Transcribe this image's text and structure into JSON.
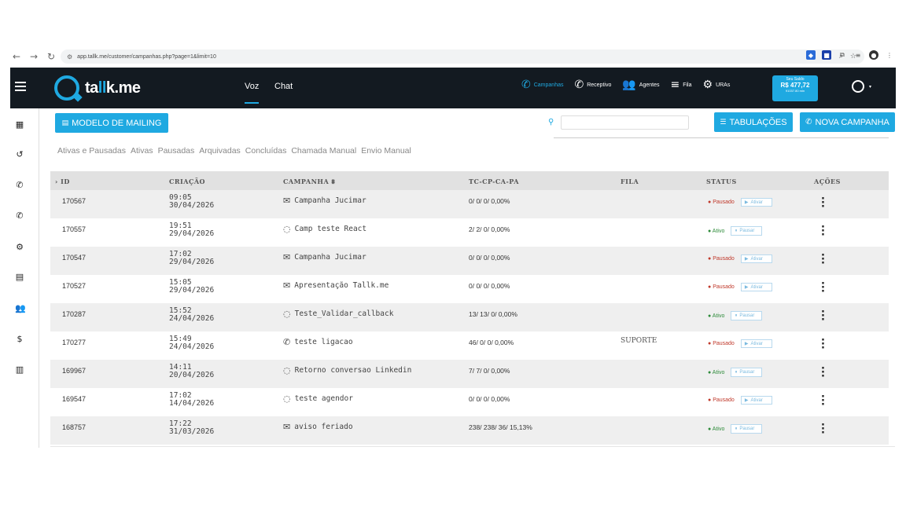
{
  "browser": {
    "url": "app.tallk.me/customer/campanhas.php?page=1&limit=10"
  },
  "topnav": {
    "logo_prefix": "ta",
    "logo_highlight": "ll",
    "logo_suffix": "k.me",
    "tabs": [
      "Voz",
      "Chat"
    ],
    "links": [
      "Campanhas",
      "Receptivo",
      "Agentes",
      "Fila",
      "URAs"
    ],
    "saldo_label": "Seu Saldo",
    "saldo_value": "R$ 477,72",
    "saldo_sub": "91037.80 min"
  },
  "toolbar": {
    "mailing_button": "MODELO DE MAILING",
    "tabulacoes_button": "TABULAÇÕES",
    "nova_campanha_button": "NOVA CAMPANHA",
    "search_placeholder": ""
  },
  "filters": [
    "Ativas e Pausadas",
    "Ativas",
    "Pausadas",
    "Arquivadas",
    "Concluídas",
    "Chamada Manual",
    "Envio Manual"
  ],
  "table": {
    "headers": {
      "id": "ID",
      "criacao": "CRIAÇÃO",
      "campanha": "CAMPANHA",
      "tc": "TC-CP-CA-PA",
      "fila": "FILA",
      "status": "STATUS",
      "acoes": "AÇÕES"
    },
    "rows": [
      {
        "id": "170567",
        "time": "09:05",
        "date": "30/04/2026",
        "icon": "envelope-icon",
        "name": "Campanha Jucimar",
        "tc": "0/ 0/ 0/ 0,00%",
        "fila": "",
        "status": "Pausado",
        "action": "Ativar"
      },
      {
        "id": "170557",
        "time": "19:51",
        "date": "29/04/2026",
        "icon": "whatsapp-icon",
        "name": "Camp teste React",
        "tc": "2/ 2/ 0/ 0,00%",
        "fila": "",
        "status": "Ativo",
        "action": "Pausar"
      },
      {
        "id": "170547",
        "time": "17:02",
        "date": "29/04/2026",
        "icon": "envelope-icon",
        "name": "Campanha Jucimar",
        "tc": "0/ 0/ 0/ 0,00%",
        "fila": "",
        "status": "Pausado",
        "action": "Ativar"
      },
      {
        "id": "170527",
        "time": "15:05",
        "date": "29/04/2026",
        "icon": "envelope-icon",
        "name": "Apresentação Tallk.me",
        "tc": "0/ 0/ 0/ 0,00%",
        "fila": "",
        "status": "Pausado",
        "action": "Ativar"
      },
      {
        "id": "170287",
        "time": "15:52",
        "date": "24/04/2026",
        "icon": "whatsapp-icon",
        "name": "Teste_Validar_callback",
        "tc": "13/ 13/ 0/ 0,00%",
        "fila": "",
        "status": "Ativo",
        "action": "Pausar"
      },
      {
        "id": "170277",
        "time": "15:49",
        "date": "24/04/2026",
        "icon": "phone-icon",
        "name": "teste ligacao",
        "tc": "46/ 0/ 0/ 0,00%",
        "fila": "SUPORTE",
        "status": "Pausado",
        "action": "Ativar"
      },
      {
        "id": "169967",
        "time": "14:11",
        "date": "20/04/2026",
        "icon": "whatsapp-icon",
        "name": "Retorno conversao Linkedin",
        "tc": "7/ 7/ 0/ 0,00%",
        "fila": "",
        "status": "Ativo",
        "action": "Pausar"
      },
      {
        "id": "169547",
        "time": "17:02",
        "date": "14/04/2026",
        "icon": "whatsapp-icon",
        "name": "teste agendor",
        "tc": "0/ 0/ 0/ 0,00%",
        "fila": "",
        "status": "Pausado",
        "action": "Ativar"
      },
      {
        "id": "168757",
        "time": "17:22",
        "date": "31/03/2026",
        "icon": "envelope-icon",
        "name": "aviso feriado",
        "tc": "238/ 238/ 36/ 15,13%",
        "fila": "",
        "status": "Ativo",
        "action": "Pausar"
      }
    ]
  },
  "colors": {
    "accent": "#1fa9e1",
    "nav_bg": "#131a21",
    "pausado": "#c0392b",
    "ativo": "#2e8b3a"
  }
}
